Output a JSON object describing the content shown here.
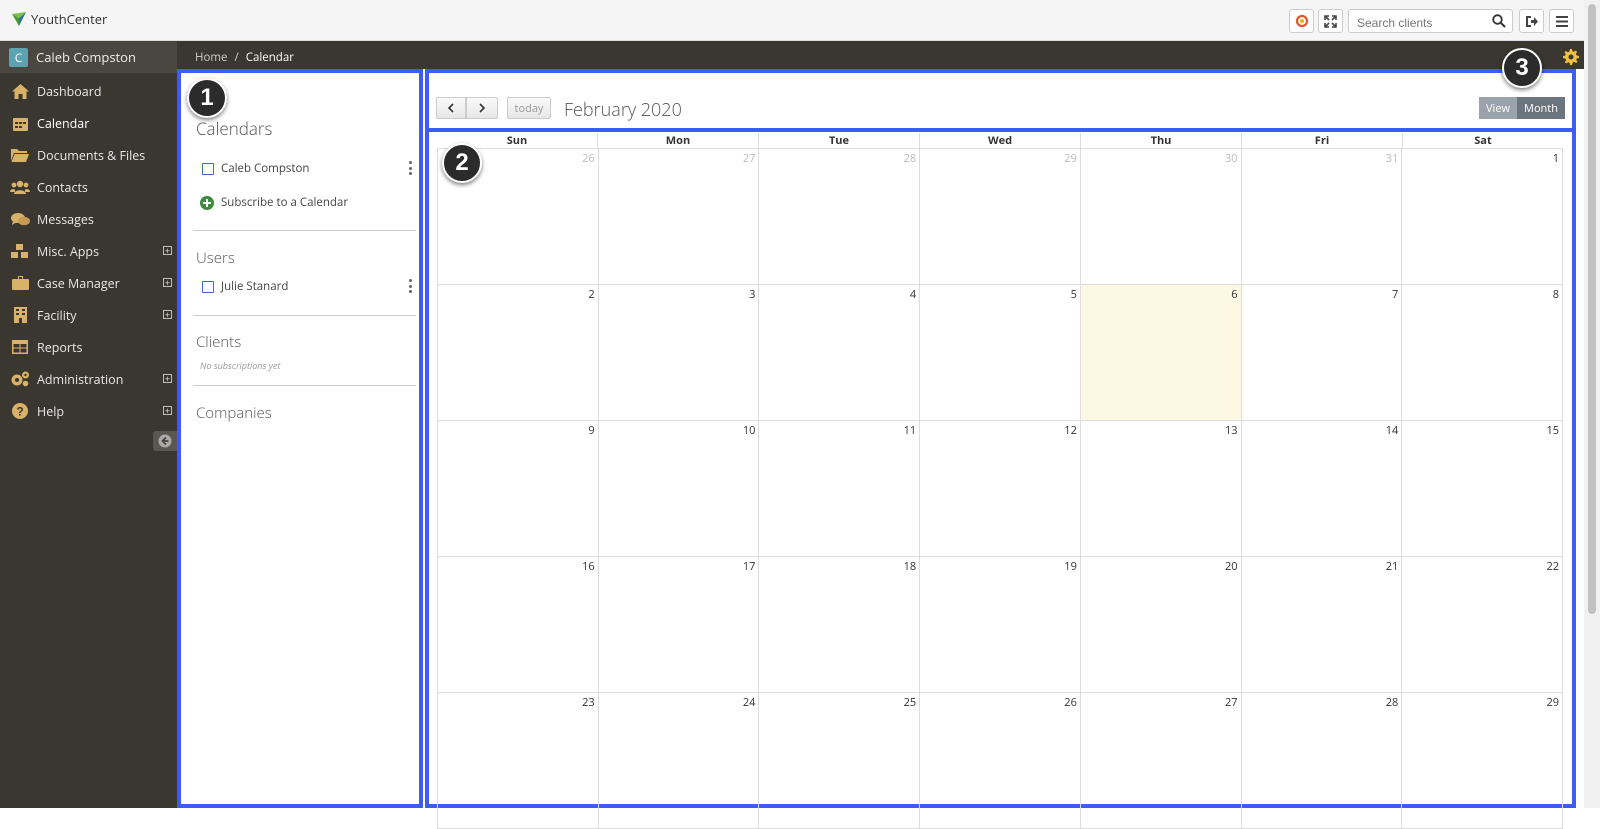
{
  "app": {
    "name": "YouthCenter"
  },
  "search": {
    "placeholder": "Search clients"
  },
  "user": {
    "initial": "C",
    "name": "Caleb Compston"
  },
  "nav": [
    {
      "label": "Dashboard",
      "icon": "home-icon"
    },
    {
      "label": "Calendar",
      "icon": "calendar-icon"
    },
    {
      "label": "Documents & Files",
      "icon": "folder-icon"
    },
    {
      "label": "Contacts",
      "icon": "users-icon"
    },
    {
      "label": "Messages",
      "icon": "comments-icon"
    },
    {
      "label": "Misc. Apps",
      "icon": "cubes-icon"
    },
    {
      "label": "Case Manager",
      "icon": "briefcase-icon"
    },
    {
      "label": "Facility",
      "icon": "building-icon"
    },
    {
      "label": "Reports",
      "icon": "table-icon"
    },
    {
      "label": "Administration",
      "icon": "cogs-icon"
    },
    {
      "label": "Help",
      "icon": "question-circle-icon"
    }
  ],
  "breadcrumb": {
    "home": "Home",
    "sep": "/",
    "current": "Calendar"
  },
  "left": {
    "calendars_title": "Calendars",
    "calendar_item": "Caleb Compston",
    "subscribe": "Subscribe to a Calendar",
    "users_title": "Users",
    "user_item": "Julie Stanard",
    "clients_title": "Clients",
    "no_subs": "No subscriptions yet",
    "companies_title": "Companies"
  },
  "callouts": [
    "1",
    "2",
    "3"
  ],
  "calendar": {
    "title": "February 2020",
    "today_label": "today",
    "view_label": "View",
    "view_month": "Month",
    "dow": [
      "Sun",
      "Mon",
      "Tue",
      "Wed",
      "Thu",
      "Fri",
      "Sat"
    ],
    "weeks": [
      [
        "26",
        "27",
        "28",
        "29",
        "30",
        "31",
        "1"
      ],
      [
        "2",
        "3",
        "4",
        "5",
        "6",
        "7",
        "8"
      ],
      [
        "9",
        "10",
        "11",
        "12",
        "13",
        "14",
        "15"
      ],
      [
        "16",
        "17",
        "18",
        "19",
        "20",
        "21",
        "22"
      ],
      [
        "23",
        "24",
        "25",
        "26",
        "27",
        "28",
        "29"
      ]
    ],
    "other_month_first_week": 6,
    "today": "6"
  },
  "colors": {
    "highlight": "#3f5bf5",
    "sidebar": "#3a3630",
    "today_bg": "#fcf8e3"
  }
}
